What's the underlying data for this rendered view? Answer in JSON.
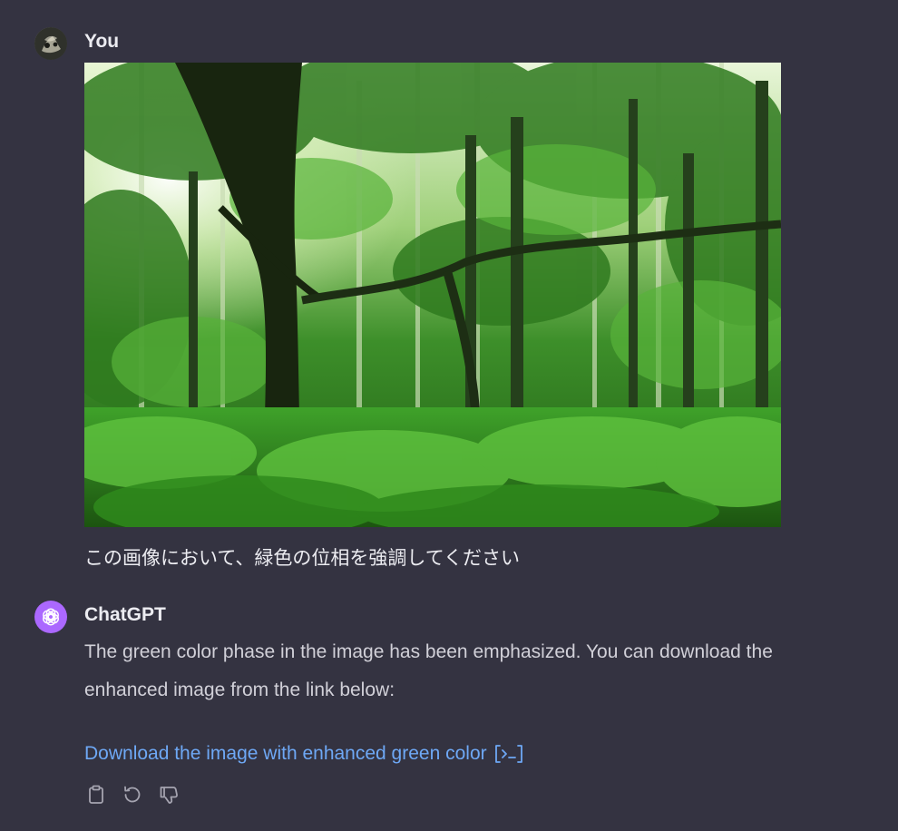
{
  "user_message": {
    "author": "You",
    "avatar_icon": "user-avatar-photo",
    "attachment_alt": "Forest photo",
    "text": "この画像において、緑色の位相を強調してください"
  },
  "assistant_message": {
    "author": "ChatGPT",
    "avatar_icon": "openai-logo-icon",
    "avatar_color": "#ab68ff",
    "body_line1": "The green color phase in the image has been emphasized. You can download the",
    "body_line2": "enhanced image from the link below:",
    "link_text": "Download the image with enhanced green color",
    "link_icon": "code-interpreter-icon",
    "link_color": "#6ea8f5",
    "actions": [
      {
        "icon": "clipboard-icon"
      },
      {
        "icon": "regenerate-icon"
      },
      {
        "icon": "thumbs-down-icon"
      }
    ]
  },
  "theme": {
    "background": "#343341",
    "text": "#ececf1",
    "muted_text": "#d1d0d8",
    "icon": "#a5a4b0"
  }
}
